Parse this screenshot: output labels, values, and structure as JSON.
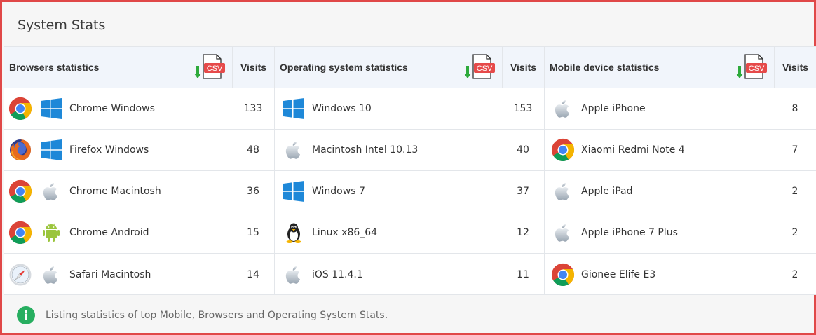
{
  "page": {
    "title": "System Stats",
    "footer_text": "Listing statistics of top Mobile, Browsers and Operating System Stats."
  },
  "colors": {
    "accent_red": "#e04848",
    "csv_badge": "#e64a4a",
    "download_green": "#2eaa3c",
    "info_green": "#27ae60",
    "windows_blue": "#1e88d8"
  },
  "browsers": {
    "title": "Browsers statistics",
    "csv_label": "CSV",
    "visits_label": "Visits",
    "rows": [
      {
        "icons": [
          "chrome-icon",
          "windows-icon"
        ],
        "label": "Chrome Windows",
        "visits": "133"
      },
      {
        "icons": [
          "firefox-icon",
          "windows-icon"
        ],
        "label": "Firefox Windows",
        "visits": "48"
      },
      {
        "icons": [
          "chrome-icon",
          "apple-icon"
        ],
        "label": "Chrome Macintosh",
        "visits": "36"
      },
      {
        "icons": [
          "chrome-icon",
          "android-icon"
        ],
        "label": "Chrome Android",
        "visits": "15"
      },
      {
        "icons": [
          "safari-icon",
          "apple-icon"
        ],
        "label": "Safari Macintosh",
        "visits": "14"
      }
    ]
  },
  "os": {
    "title": "Operating system statistics",
    "csv_label": "CSV",
    "visits_label": "Visits",
    "rows": [
      {
        "icon": "windows-icon",
        "label": "Windows 10",
        "visits": "153"
      },
      {
        "icon": "apple-icon",
        "label": "Macintosh Intel 10.13",
        "visits": "40"
      },
      {
        "icon": "windows-icon",
        "label": "Windows 7",
        "visits": "37"
      },
      {
        "icon": "linux-icon",
        "label": "Linux x86_64",
        "visits": "12"
      },
      {
        "icon": "apple-icon",
        "label": "iOS 11.4.1",
        "visits": "11"
      }
    ]
  },
  "mobile": {
    "title": "Mobile device statistics",
    "csv_label": "CSV",
    "visits_label": "Visits",
    "rows": [
      {
        "icon": "apple-icon",
        "label": "Apple iPhone",
        "visits": "8"
      },
      {
        "icon": "chrome-icon",
        "label": "Xiaomi Redmi Note 4",
        "visits": "7"
      },
      {
        "icon": "apple-icon",
        "label": "Apple iPad",
        "visits": "2"
      },
      {
        "icon": "apple-icon",
        "label": "Apple iPhone 7 Plus",
        "visits": "2"
      },
      {
        "icon": "chrome-icon",
        "label": "Gionee Elife E3",
        "visits": "2"
      }
    ]
  }
}
